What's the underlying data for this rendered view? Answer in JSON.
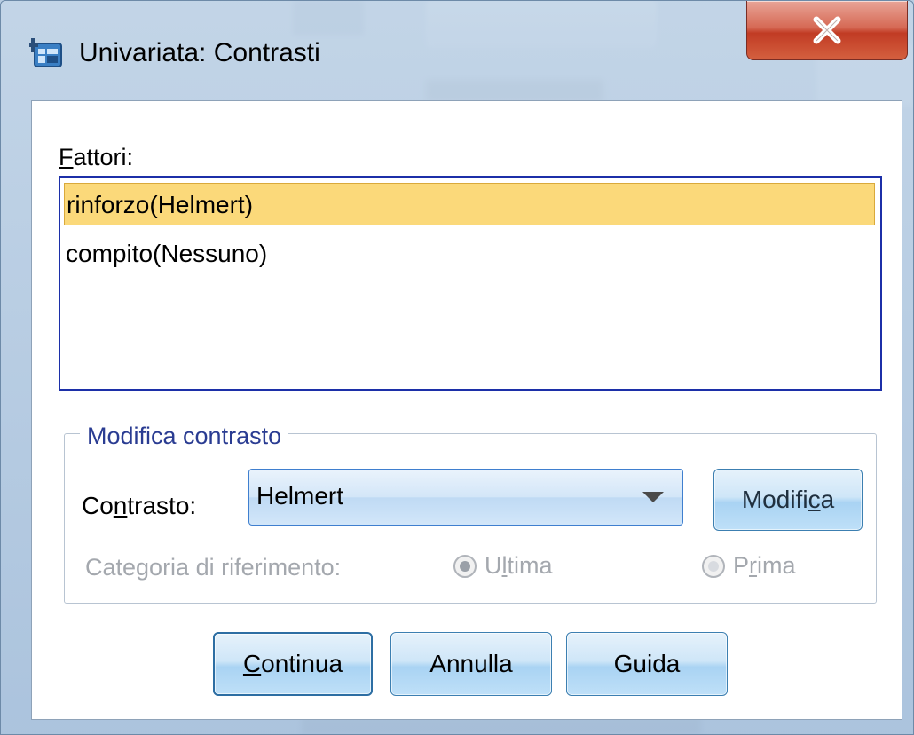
{
  "window": {
    "title": "Univariata: Contrasti",
    "close_label": "X"
  },
  "factors": {
    "label_first": "F",
    "label_rest": "attori:",
    "items": [
      {
        "label": "rinforzo(Helmert)",
        "selected": true
      },
      {
        "label": "compito(Nessuno)",
        "selected": false
      }
    ]
  },
  "change_contrast": {
    "legend": "Modifica contrasto",
    "contrast_label_pre": "Co",
    "contrast_label_u": "n",
    "contrast_label_post": "trasto:",
    "contrast_value": "Helmert",
    "modify_pre": "Modifi",
    "modify_u": "c",
    "modify_post": "a",
    "reference_label": "Categoria di riferimento:",
    "ultima_pre": "U",
    "ultima_u": "l",
    "ultima_post": "tima",
    "prima_pre": "P",
    "prima_u": "r",
    "prima_post": "ima"
  },
  "buttons": {
    "continue_u": "C",
    "continue_rest": "ontinua",
    "cancel": "Annulla",
    "help": "Guida"
  },
  "colors": {
    "selection": "#fbd97a",
    "list_border": "#1c2fa8",
    "legend_text": "#2a3c92",
    "disabled_text": "#a4a8ae",
    "close_button": "#c13b24"
  }
}
